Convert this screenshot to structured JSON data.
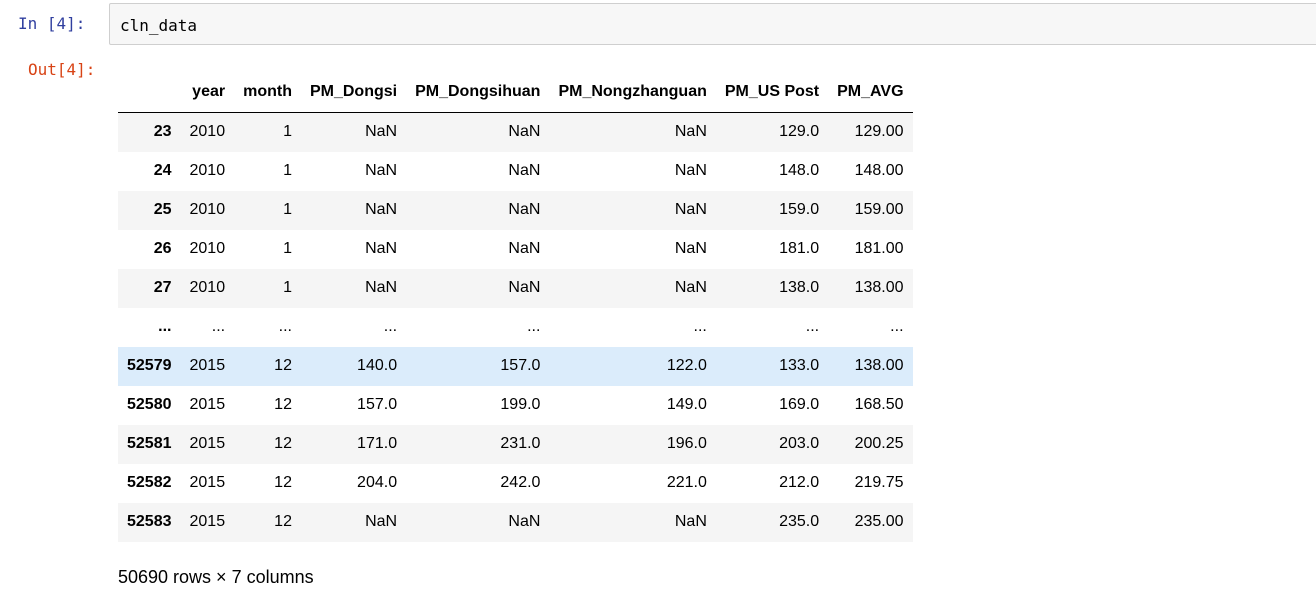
{
  "input_prompt": "In  [4]:",
  "output_prompt": "Out[4]:",
  "code": "cln_data",
  "table": {
    "columns": [
      "year",
      "month",
      "PM_Dongsi",
      "PM_Dongsihuan",
      "PM_Nongzhanguan",
      "PM_US Post",
      "PM_AVG"
    ],
    "rows": [
      {
        "index": "23",
        "cells": [
          "2010",
          "1",
          "NaN",
          "NaN",
          "NaN",
          "129.0",
          "129.00"
        ]
      },
      {
        "index": "24",
        "cells": [
          "2010",
          "1",
          "NaN",
          "NaN",
          "NaN",
          "148.0",
          "148.00"
        ]
      },
      {
        "index": "25",
        "cells": [
          "2010",
          "1",
          "NaN",
          "NaN",
          "NaN",
          "159.0",
          "159.00"
        ]
      },
      {
        "index": "26",
        "cells": [
          "2010",
          "1",
          "NaN",
          "NaN",
          "NaN",
          "181.0",
          "181.00"
        ]
      },
      {
        "index": "27",
        "cells": [
          "2010",
          "1",
          "NaN",
          "NaN",
          "NaN",
          "138.0",
          "138.00"
        ]
      },
      {
        "index": "...",
        "cells": [
          "...",
          "...",
          "...",
          "...",
          "...",
          "...",
          "..."
        ]
      },
      {
        "index": "52579",
        "cells": [
          "2015",
          "12",
          "140.0",
          "157.0",
          "122.0",
          "133.0",
          "138.00"
        ],
        "hovered": true
      },
      {
        "index": "52580",
        "cells": [
          "2015",
          "12",
          "157.0",
          "199.0",
          "149.0",
          "169.0",
          "168.50"
        ]
      },
      {
        "index": "52581",
        "cells": [
          "2015",
          "12",
          "171.0",
          "231.0",
          "196.0",
          "203.0",
          "200.25"
        ]
      },
      {
        "index": "52582",
        "cells": [
          "2015",
          "12",
          "204.0",
          "242.0",
          "221.0",
          "212.0",
          "219.75"
        ]
      },
      {
        "index": "52583",
        "cells": [
          "2015",
          "12",
          "NaN",
          "NaN",
          "NaN",
          "235.0",
          "235.00"
        ]
      }
    ]
  },
  "shape_info": "50690 rows × 7 columns",
  "colors": {
    "input_prompt": "#303f9f",
    "output_prompt": "#d84315",
    "hover_row": "#dbecfb",
    "stripe_row": "#f5f5f5"
  }
}
